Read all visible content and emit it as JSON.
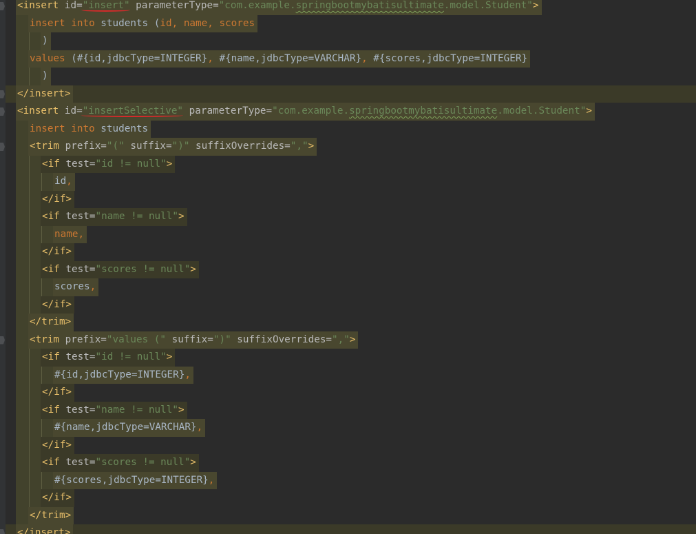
{
  "editor": {
    "colors": {
      "background": "#2b2b2b",
      "line_highlight": "#49472f",
      "tag": "#e8bf6a",
      "string": "#6a8759",
      "keyword": "#cc7832",
      "text": "#a9b7c6",
      "annotation_underline": "#d42a2a"
    },
    "lines": [
      {
        "indent": 0,
        "segs": [
          [
            "tag",
            "<insert "
          ],
          [
            "attr",
            "id="
          ],
          [
            "str",
            "\"insert\""
          ],
          [
            "attr",
            " parameterType="
          ],
          [
            "str",
            "\"com.example."
          ],
          [
            "strsq",
            "springbootmybatisultimate"
          ],
          [
            "str",
            ".model.Student\""
          ],
          [
            "tag",
            ">"
          ]
        ]
      },
      {
        "indent": 1,
        "segs": [
          [
            "sql",
            "insert into "
          ],
          [
            "plain",
            "students ("
          ],
          [
            "sql",
            "id"
          ],
          [
            "punct",
            ", "
          ],
          [
            "sql",
            "name"
          ],
          [
            "punct",
            ", "
          ],
          [
            "sql",
            "scores"
          ]
        ]
      },
      {
        "indent": 2,
        "segs": [
          [
            "plain",
            ")"
          ]
        ]
      },
      {
        "indent": 1,
        "segs": [
          [
            "sql",
            "values "
          ],
          [
            "plain",
            "(#{id,jdbcType=INTEGER}"
          ],
          [
            "punct",
            ", "
          ],
          [
            "plain",
            "#{name,jdbcType=VARCHAR}"
          ],
          [
            "punct",
            ", "
          ],
          [
            "plain",
            "#{scores,jdbcType=INTEGER}"
          ]
        ]
      },
      {
        "indent": 2,
        "segs": [
          [
            "plain",
            ")"
          ]
        ]
      },
      {
        "indent": 0,
        "segs": [
          [
            "tag",
            "</insert>"
          ]
        ]
      },
      {
        "indent": 0,
        "segs": [
          [
            "tag",
            "<insert "
          ],
          [
            "attr",
            "id="
          ],
          [
            "str",
            "\"insertSelective\""
          ],
          [
            "attr",
            " parameterType="
          ],
          [
            "str",
            "\"com.example."
          ],
          [
            "strsq",
            "springbootmybatisultimate"
          ],
          [
            "str",
            ".model.Student\""
          ],
          [
            "tag",
            ">"
          ]
        ]
      },
      {
        "indent": 1,
        "segs": [
          [
            "sql",
            "insert into "
          ],
          [
            "plain",
            "students"
          ]
        ]
      },
      {
        "indent": 1,
        "segs": [
          [
            "tag",
            "<trim "
          ],
          [
            "attr",
            "prefix="
          ],
          [
            "str",
            "\"(\""
          ],
          [
            "attr",
            " suffix="
          ],
          [
            "str",
            "\")\""
          ],
          [
            "attr",
            " suffixOverrides="
          ],
          [
            "str",
            "\",\""
          ],
          [
            "tag",
            ">"
          ]
        ]
      },
      {
        "indent": 2,
        "segs": [
          [
            "tag",
            "<if "
          ],
          [
            "attr",
            "test="
          ],
          [
            "str",
            "\"id != null\""
          ],
          [
            "tag",
            ">"
          ]
        ]
      },
      {
        "indent": 3,
        "segs": [
          [
            "plain",
            "id"
          ],
          [
            "punct",
            ","
          ]
        ]
      },
      {
        "indent": 2,
        "segs": [
          [
            "tag",
            "</if>"
          ]
        ]
      },
      {
        "indent": 2,
        "segs": [
          [
            "tag",
            "<if "
          ],
          [
            "attr",
            "test="
          ],
          [
            "str",
            "\"name != null\""
          ],
          [
            "tag",
            ">"
          ]
        ]
      },
      {
        "indent": 3,
        "segs": [
          [
            "sql",
            "name"
          ],
          [
            "punct",
            ","
          ]
        ]
      },
      {
        "indent": 2,
        "segs": [
          [
            "tag",
            "</if>"
          ]
        ]
      },
      {
        "indent": 2,
        "segs": [
          [
            "tag",
            "<if "
          ],
          [
            "attr",
            "test="
          ],
          [
            "str",
            "\"scores != null\""
          ],
          [
            "tag",
            ">"
          ]
        ]
      },
      {
        "indent": 3,
        "segs": [
          [
            "plain",
            "scores"
          ],
          [
            "punct",
            ","
          ]
        ]
      },
      {
        "indent": 2,
        "segs": [
          [
            "tag",
            "</if>"
          ]
        ]
      },
      {
        "indent": 1,
        "segs": [
          [
            "tag",
            "</trim>"
          ]
        ]
      },
      {
        "indent": 1,
        "segs": [
          [
            "tag",
            "<trim "
          ],
          [
            "attr",
            "prefix="
          ],
          [
            "str",
            "\"values (\""
          ],
          [
            "attr",
            " suffix="
          ],
          [
            "str",
            "\")\""
          ],
          [
            "attr",
            " suffixOverrides="
          ],
          [
            "str",
            "\",\""
          ],
          [
            "tag",
            ">"
          ]
        ]
      },
      {
        "indent": 2,
        "segs": [
          [
            "tag",
            "<if "
          ],
          [
            "attr",
            "test="
          ],
          [
            "str",
            "\"id != null\""
          ],
          [
            "tag",
            ">"
          ]
        ]
      },
      {
        "indent": 3,
        "segs": [
          [
            "plain",
            "#{id,jdbcType=INTEGER}"
          ],
          [
            "punct",
            ","
          ]
        ]
      },
      {
        "indent": 2,
        "segs": [
          [
            "tag",
            "</if>"
          ]
        ]
      },
      {
        "indent": 2,
        "segs": [
          [
            "tag",
            "<if "
          ],
          [
            "attr",
            "test="
          ],
          [
            "str",
            "\"name != null\""
          ],
          [
            "tag",
            ">"
          ]
        ]
      },
      {
        "indent": 3,
        "segs": [
          [
            "plain",
            "#{name,jdbcType=VARCHAR}"
          ],
          [
            "punct",
            ","
          ]
        ]
      },
      {
        "indent": 2,
        "segs": [
          [
            "tag",
            "</if>"
          ]
        ]
      },
      {
        "indent": 2,
        "segs": [
          [
            "tag",
            "<if "
          ],
          [
            "attr",
            "test="
          ],
          [
            "str",
            "\"scores != null\""
          ],
          [
            "tag",
            ">"
          ]
        ]
      },
      {
        "indent": 3,
        "segs": [
          [
            "plain",
            "#{scores,jdbcType=INTEGER}"
          ],
          [
            "punct",
            ","
          ]
        ]
      },
      {
        "indent": 2,
        "segs": [
          [
            "tag",
            "</if>"
          ]
        ]
      },
      {
        "indent": 1,
        "segs": [
          [
            "tag",
            "</trim>"
          ]
        ]
      },
      {
        "indent": 0,
        "segs": [
          [
            "tag",
            "</insert>"
          ]
        ]
      }
    ]
  }
}
